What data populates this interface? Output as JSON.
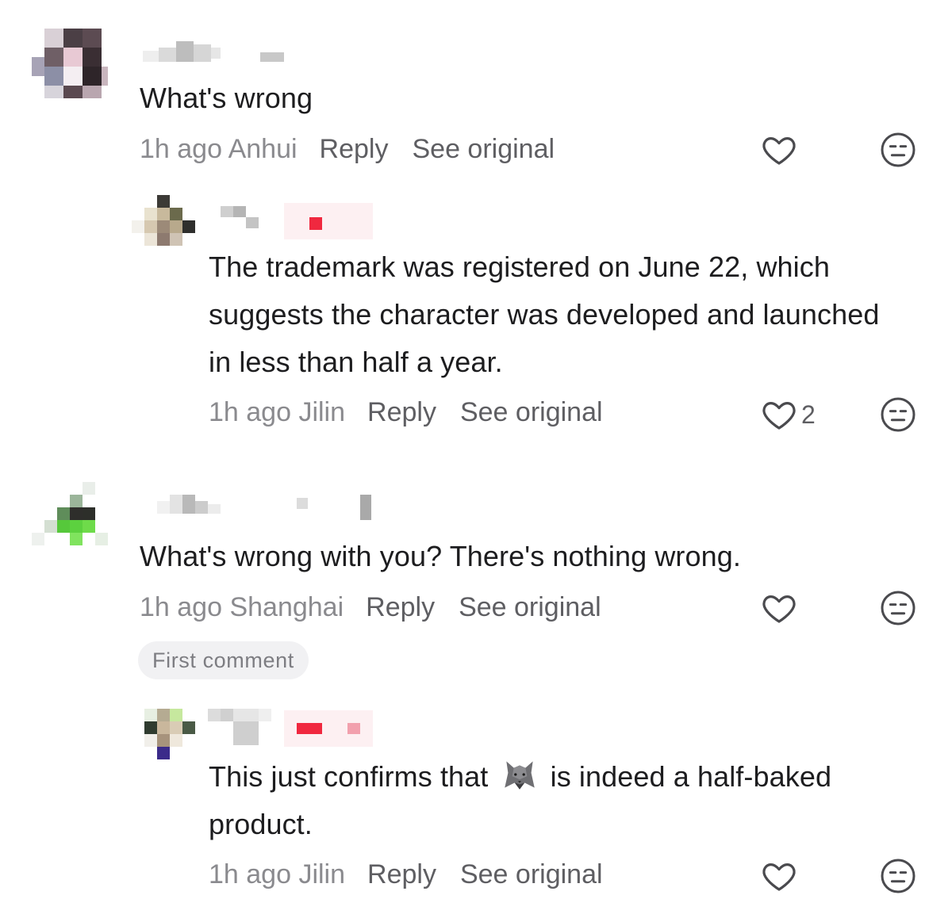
{
  "icons": {
    "like": "heart-outline-icon",
    "dislike": "expressionless-face-icon",
    "inline_emoji": "wolf-emoji-icon"
  },
  "colors": {
    "text_primary": "#1d1d1f",
    "text_secondary": "#8a8a8e",
    "action_text": "#5e5e62",
    "badge_bg": "#f1f1f3",
    "icon_stroke": "#4a4a4e"
  },
  "comments": [
    {
      "text": "What's wrong",
      "time": "1h ago",
      "location": "Anhui",
      "reply_label": "Reply",
      "see_original_label": "See original",
      "like_count": ""
    },
    {
      "text": "The trademark was registered on June 22, which suggests the character was developed and launched in less than half a year.",
      "time": "1h ago",
      "location": "Jilin",
      "reply_label": "Reply",
      "see_original_label": "See original",
      "like_count": "2"
    },
    {
      "text": "What's wrong with you? There's nothing wrong.",
      "time": "1h ago",
      "location": "Shanghai",
      "reply_label": "Reply",
      "see_original_label": "See original",
      "like_count": "",
      "badge": "First comment"
    },
    {
      "text_before_emoji": "This just confirms that",
      "text_after_emoji": "is indeed a half-baked product.",
      "time": "1h ago",
      "location": "Jilin",
      "reply_label": "Reply",
      "see_original_label": "See original",
      "like_count": ""
    }
  ]
}
